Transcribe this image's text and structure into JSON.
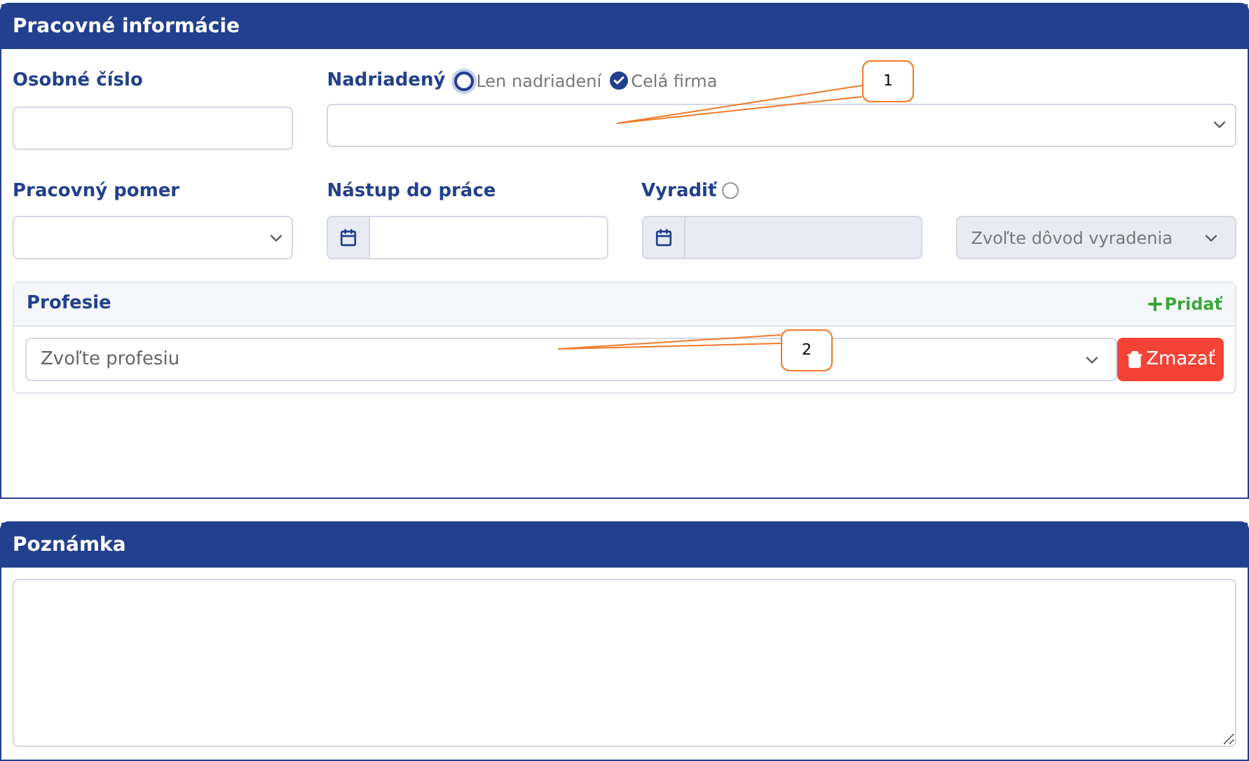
{
  "work_panel": {
    "title": "Pracovné informácie",
    "personal_number": {
      "label": "Osobné číslo"
    },
    "supervisor": {
      "label": "Nadriadený",
      "options": [
        {
          "label": "Len nadriadení",
          "selected": false
        },
        {
          "label": "Celá firma",
          "selected": true
        }
      ]
    },
    "employment_type": {
      "label": "Pracovný pomer"
    },
    "start_date": {
      "label": "Nástup do práce",
      "disabled": false
    },
    "discard": {
      "label": "Vyradiť",
      "checked": false,
      "date_disabled": true,
      "reason": {
        "placeholder": "Zvoľte dôvod vyradenia",
        "disabled": true
      }
    },
    "professions": {
      "title": "Profesie",
      "add": "Pridať",
      "rows": [
        {
          "placeholder": "Zvoľte profesiu",
          "delete": "Zmazať"
        }
      ]
    }
  },
  "callouts": [
    {
      "label": "1"
    },
    {
      "label": "2"
    }
  ],
  "note_panel": {
    "title": "Poznámka"
  }
}
